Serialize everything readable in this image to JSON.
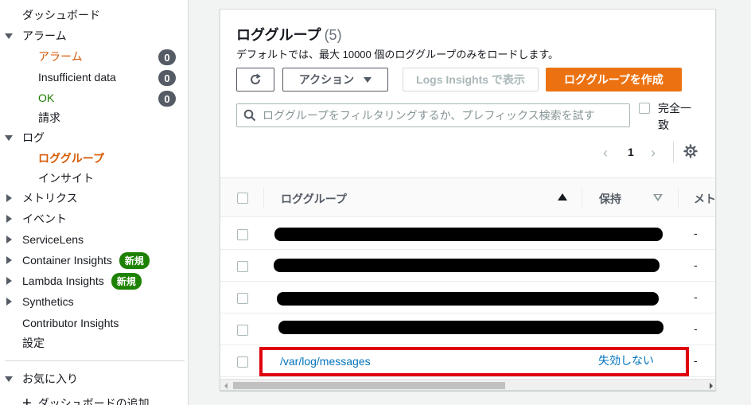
{
  "sidebar": {
    "dashboard": "ダッシュボード",
    "alarms": {
      "label": "アラーム",
      "items": [
        {
          "label": "アラーム",
          "count": "0"
        },
        {
          "label": "Insufficient data",
          "count": "0"
        },
        {
          "label": "OK",
          "count": "0"
        }
      ]
    },
    "billing": "請求",
    "logs": {
      "label": "ログ",
      "items": [
        {
          "label": "ロググループ"
        },
        {
          "label": "インサイト"
        }
      ]
    },
    "metrics": "メトリクス",
    "events": "イベント",
    "servicelens": "ServiceLens",
    "container_insights": "Container Insights",
    "lambda_insights": "Lambda Insights",
    "new_badge": "新規",
    "synthetics": "Synthetics",
    "contributor_insights": "Contributor Insights",
    "settings": "設定",
    "favorites": "お気に入り",
    "add_dashboard": "ダッシュボードの追加"
  },
  "panel": {
    "title": "ロググループ",
    "count": "(5)",
    "description": "デフォルトでは、最大 10000 個のロググループのみをロードします。",
    "actions_label": "アクション",
    "logs_insights_label": "Logs Insights で表示",
    "create_label": "ロググループを作成",
    "search_placeholder": "ロググループをフィルタリングするか、プレフィックス検索を試す",
    "exact_match_label": "完全一致",
    "page_number": "1"
  },
  "table": {
    "columns": [
      "ロググループ",
      "保持",
      "メト"
    ],
    "rows": [
      {
        "name": "",
        "retention": "",
        "metric": "-",
        "redacted": true
      },
      {
        "name": "",
        "retention": "",
        "metric": "-",
        "redacted": true
      },
      {
        "name": "",
        "retention": "",
        "metric": "-",
        "redacted": true
      },
      {
        "name": "",
        "retention": "",
        "metric": "-",
        "redacted": true
      },
      {
        "name": "/var/log/messages",
        "retention": "失効しない",
        "metric": "-",
        "redacted": false
      }
    ]
  },
  "colors": {
    "accent_orange": "#ec7211",
    "active_nav": "#d45b07",
    "ok_green": "#1d8102",
    "link_blue": "#0073bb",
    "highlight_red": "#e0000d"
  }
}
